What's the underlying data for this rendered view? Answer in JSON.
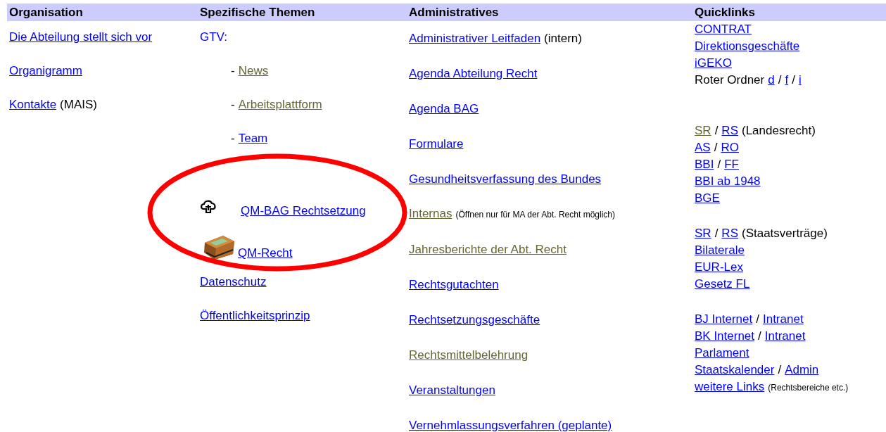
{
  "columns": [
    {
      "heading": "Organisation",
      "kind": "list",
      "items": [
        {
          "kind": "line",
          "parts": [
            {
              "kind": "link",
              "text": "Die Abteilung stellt sich vor",
              "visited": false
            }
          ]
        },
        {
          "kind": "line",
          "parts": [
            {
              "kind": "link",
              "text": "Organigramm",
              "visited": false
            }
          ]
        },
        {
          "kind": "line",
          "parts": [
            {
              "kind": "link",
              "text": "Kontakte",
              "visited": false
            },
            {
              "kind": "text",
              "text": "(MAIS)"
            }
          ]
        }
      ]
    },
    {
      "heading": "Spezifische Themen",
      "kind": "list",
      "items": [
        {
          "kind": "line",
          "parts": [
            {
              "kind": "label",
              "text": "GTV:"
            }
          ]
        },
        {
          "kind": "sub",
          "parts": [
            {
              "kind": "text",
              "text": "-"
            },
            {
              "kind": "link",
              "text": "News",
              "visited": true
            }
          ]
        },
        {
          "kind": "sub",
          "parts": [
            {
              "kind": "text",
              "text": "-"
            },
            {
              "kind": "link",
              "text": "Arbeitsplattform",
              "visited": true
            }
          ]
        },
        {
          "kind": "sub",
          "parts": [
            {
              "kind": "text",
              "text": "-"
            },
            {
              "kind": "link",
              "text": "Team",
              "visited": false
            }
          ]
        },
        {
          "kind": "symbol-link",
          "parts": [
            {
              "kind": "link",
              "text": "QM-BAG Rechtsetzung",
              "visited": false
            }
          ]
        },
        {
          "kind": "picture-link",
          "parts": [
            {
              "kind": "link",
              "text": "QM-Recht",
              "visited": false
            }
          ]
        },
        {
          "kind": "line",
          "parts": [
            {
              "kind": "link",
              "text": "Datenschutz",
              "visited": false
            }
          ]
        },
        {
          "kind": "line",
          "parts": [
            {
              "kind": "link",
              "text": "Öffentlichkeitsprinzip",
              "visited": false
            }
          ]
        }
      ]
    },
    {
      "heading": "Administratives",
      "kind": "list",
      "items": [
        {
          "kind": "line",
          "parts": [
            {
              "kind": "link",
              "text": "Administrativer Leitfaden",
              "visited": false
            },
            {
              "kind": "text",
              "text": "(intern)"
            }
          ]
        },
        {
          "kind": "line",
          "parts": [
            {
              "kind": "link",
              "text": "Agenda Abteilung Recht",
              "visited": false
            }
          ]
        },
        {
          "kind": "line",
          "parts": [
            {
              "kind": "link",
              "text": "Agenda BAG",
              "visited": false
            }
          ]
        },
        {
          "kind": "line",
          "parts": [
            {
              "kind": "link",
              "text": "Formulare",
              "visited": false
            }
          ]
        },
        {
          "kind": "line",
          "parts": [
            {
              "kind": "link",
              "text": "Gesundheitsverfassung des Bundes",
              "visited": false
            }
          ]
        },
        {
          "kind": "line",
          "parts": [
            {
              "kind": "link",
              "text": "Internas",
              "visited": true
            },
            {
              "kind": "note",
              "text": "(Öffnen nur für MA der Abt. Recht möglich)"
            }
          ]
        },
        {
          "kind": "line",
          "parts": [
            {
              "kind": "link",
              "text": "Jahresberichte der Abt. Recht",
              "visited": true
            }
          ]
        },
        {
          "kind": "line",
          "parts": [
            {
              "kind": "link",
              "text": "Rechtsgutachten",
              "visited": false
            }
          ]
        },
        {
          "kind": "line",
          "parts": [
            {
              "kind": "link",
              "text": "Rechtsetzungsgeschäfte",
              "visited": false
            }
          ]
        },
        {
          "kind": "line",
          "parts": [
            {
              "kind": "link",
              "text": "Rechtsmittelbelehrung",
              "visited": true
            }
          ]
        },
        {
          "kind": "line",
          "parts": [
            {
              "kind": "link",
              "text": "Veranstaltungen",
              "visited": false
            }
          ]
        },
        {
          "kind": "line",
          "parts": [
            {
              "kind": "link",
              "text": "Vernehmlassungsverfahren (geplante)",
              "visited": false
            }
          ]
        }
      ]
    },
    {
      "heading": "Quicklinks",
      "kind": "quicklinks",
      "groups": [
        [
          {
            "parts": [
              {
                "kind": "link",
                "text": "CONTRAT",
                "visited": false
              }
            ]
          },
          {
            "parts": [
              {
                "kind": "link",
                "text": "Direktionsgeschäfte",
                "visited": false
              }
            ]
          },
          {
            "parts": [
              {
                "kind": "link",
                "text": "iGEKO",
                "visited": false
              }
            ]
          },
          {
            "parts": [
              {
                "kind": "text",
                "text": "Roter Ordner"
              },
              {
                "kind": "link",
                "text": "d",
                "visited": false
              },
              {
                "kind": "text",
                "text": "/"
              },
              {
                "kind": "link",
                "text": "f",
                "visited": false
              },
              {
                "kind": "text",
                "text": "/"
              },
              {
                "kind": "link",
                "text": "i",
                "visited": false
              }
            ]
          }
        ],
        [
          {
            "parts": [
              {
                "kind": "link",
                "text": "SR",
                "visited": true
              },
              {
                "kind": "text",
                "text": "/"
              },
              {
                "kind": "link",
                "text": "RS",
                "visited": false
              },
              {
                "kind": "text",
                "text": "(Landesrecht)"
              }
            ]
          },
          {
            "parts": [
              {
                "kind": "link",
                "text": "AS",
                "visited": false
              },
              {
                "kind": "text",
                "text": "/"
              },
              {
                "kind": "link",
                "text": "RO",
                "visited": false
              }
            ]
          },
          {
            "parts": [
              {
                "kind": "link",
                "text": "BBI",
                "visited": false
              },
              {
                "kind": "text",
                "text": "/"
              },
              {
                "kind": "link",
                "text": "FF",
                "visited": false
              }
            ]
          },
          {
            "parts": [
              {
                "kind": "link",
                "text": "BBI ab 1948",
                "visited": false
              }
            ]
          },
          {
            "parts": [
              {
                "kind": "link",
                "text": "BGE",
                "visited": false
              }
            ]
          }
        ],
        [
          {
            "parts": [
              {
                "kind": "link",
                "text": "SR",
                "visited": false
              },
              {
                "kind": "text",
                "text": "/"
              },
              {
                "kind": "link",
                "text": "RS",
                "visited": false
              },
              {
                "kind": "text",
                "text": "(Staatsverträge)"
              }
            ]
          },
          {
            "parts": [
              {
                "kind": "link",
                "text": "Bilaterale",
                "visited": false
              }
            ]
          },
          {
            "parts": [
              {
                "kind": "link",
                "text": "EUR-Lex",
                "visited": false
              }
            ]
          },
          {
            "parts": [
              {
                "kind": "link",
                "text": "Gesetz FL",
                "visited": false
              }
            ]
          }
        ],
        [
          {
            "parts": [
              {
                "kind": "link",
                "text": "BJ Internet",
                "visited": false
              },
              {
                "kind": "text",
                "text": "/"
              },
              {
                "kind": "link",
                "text": "Intranet",
                "visited": false
              }
            ]
          },
          {
            "parts": [
              {
                "kind": "link",
                "text": "BK Internet",
                "visited": false
              },
              {
                "kind": "text",
                "text": "/"
              },
              {
                "kind": "link",
                "text": "Intranet",
                "visited": false
              }
            ]
          },
          {
            "parts": [
              {
                "kind": "link",
                "text": "Parlament",
                "visited": false
              }
            ]
          },
          {
            "parts": [
              {
                "kind": "link",
                "text": "Staatskalender",
                "visited": false
              },
              {
                "kind": "text",
                "text": "/"
              },
              {
                "kind": "link",
                "text": "Admin",
                "visited": false
              }
            ]
          },
          {
            "parts": [
              {
                "kind": "link",
                "text": "weitere Links",
                "visited": false
              },
              {
                "kind": "note",
                "text": "(Rechtsbereiche etc.)"
              }
            ]
          }
        ]
      ]
    }
  ]
}
